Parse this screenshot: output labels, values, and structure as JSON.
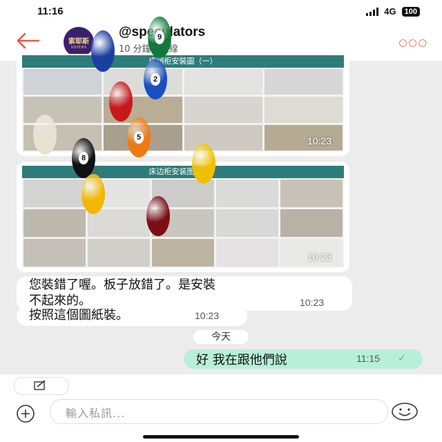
{
  "status": {
    "time": "11:16",
    "network": "4G",
    "battery": "100"
  },
  "header": {
    "contact": "@speculators",
    "subtitle": "10 分鐘前上線",
    "avatar": {
      "name": "索耶斯",
      "sub": "SOYERS"
    }
  },
  "messages": {
    "img1": {
      "banner": "床頭柜安裝圖（一）",
      "time": "10:23"
    },
    "img2": {
      "banner": "床边柜安装图（二）",
      "time": "10:23"
    },
    "m1": {
      "line1": "您裝錯了喔。板子放錯了。是安裝",
      "line2": "不起來的。",
      "time": "10:23"
    },
    "m2": {
      "text": "按照這個圖紙裝。",
      "time": "10:23"
    },
    "date": "今天",
    "m3": {
      "text": "好 我在跟他們說",
      "time": "11:15"
    }
  },
  "composer": {
    "placeholder": "輸入私訊..."
  },
  "colors": {
    "accent": "#e85a3c",
    "mine_bubble": "#b7efd9",
    "banner": "#2e7c79"
  },
  "overlay_balls": [
    {
      "number": "",
      "color": "#1a3fa0"
    },
    {
      "number": "9",
      "color": "#0f7a3a"
    },
    {
      "number": "2",
      "color": "#1a4fbf"
    },
    {
      "number": "",
      "color": "#c8181c"
    },
    {
      "number": "",
      "color": "#e8e2d0"
    },
    {
      "number": "5",
      "color": "#ef7a12"
    },
    {
      "number": "8",
      "color": "#111111"
    },
    {
      "number": "",
      "color": "#f0c000"
    },
    {
      "number": "",
      "color": "#f2b700"
    },
    {
      "number": "",
      "color": "#7a0f14"
    }
  ]
}
